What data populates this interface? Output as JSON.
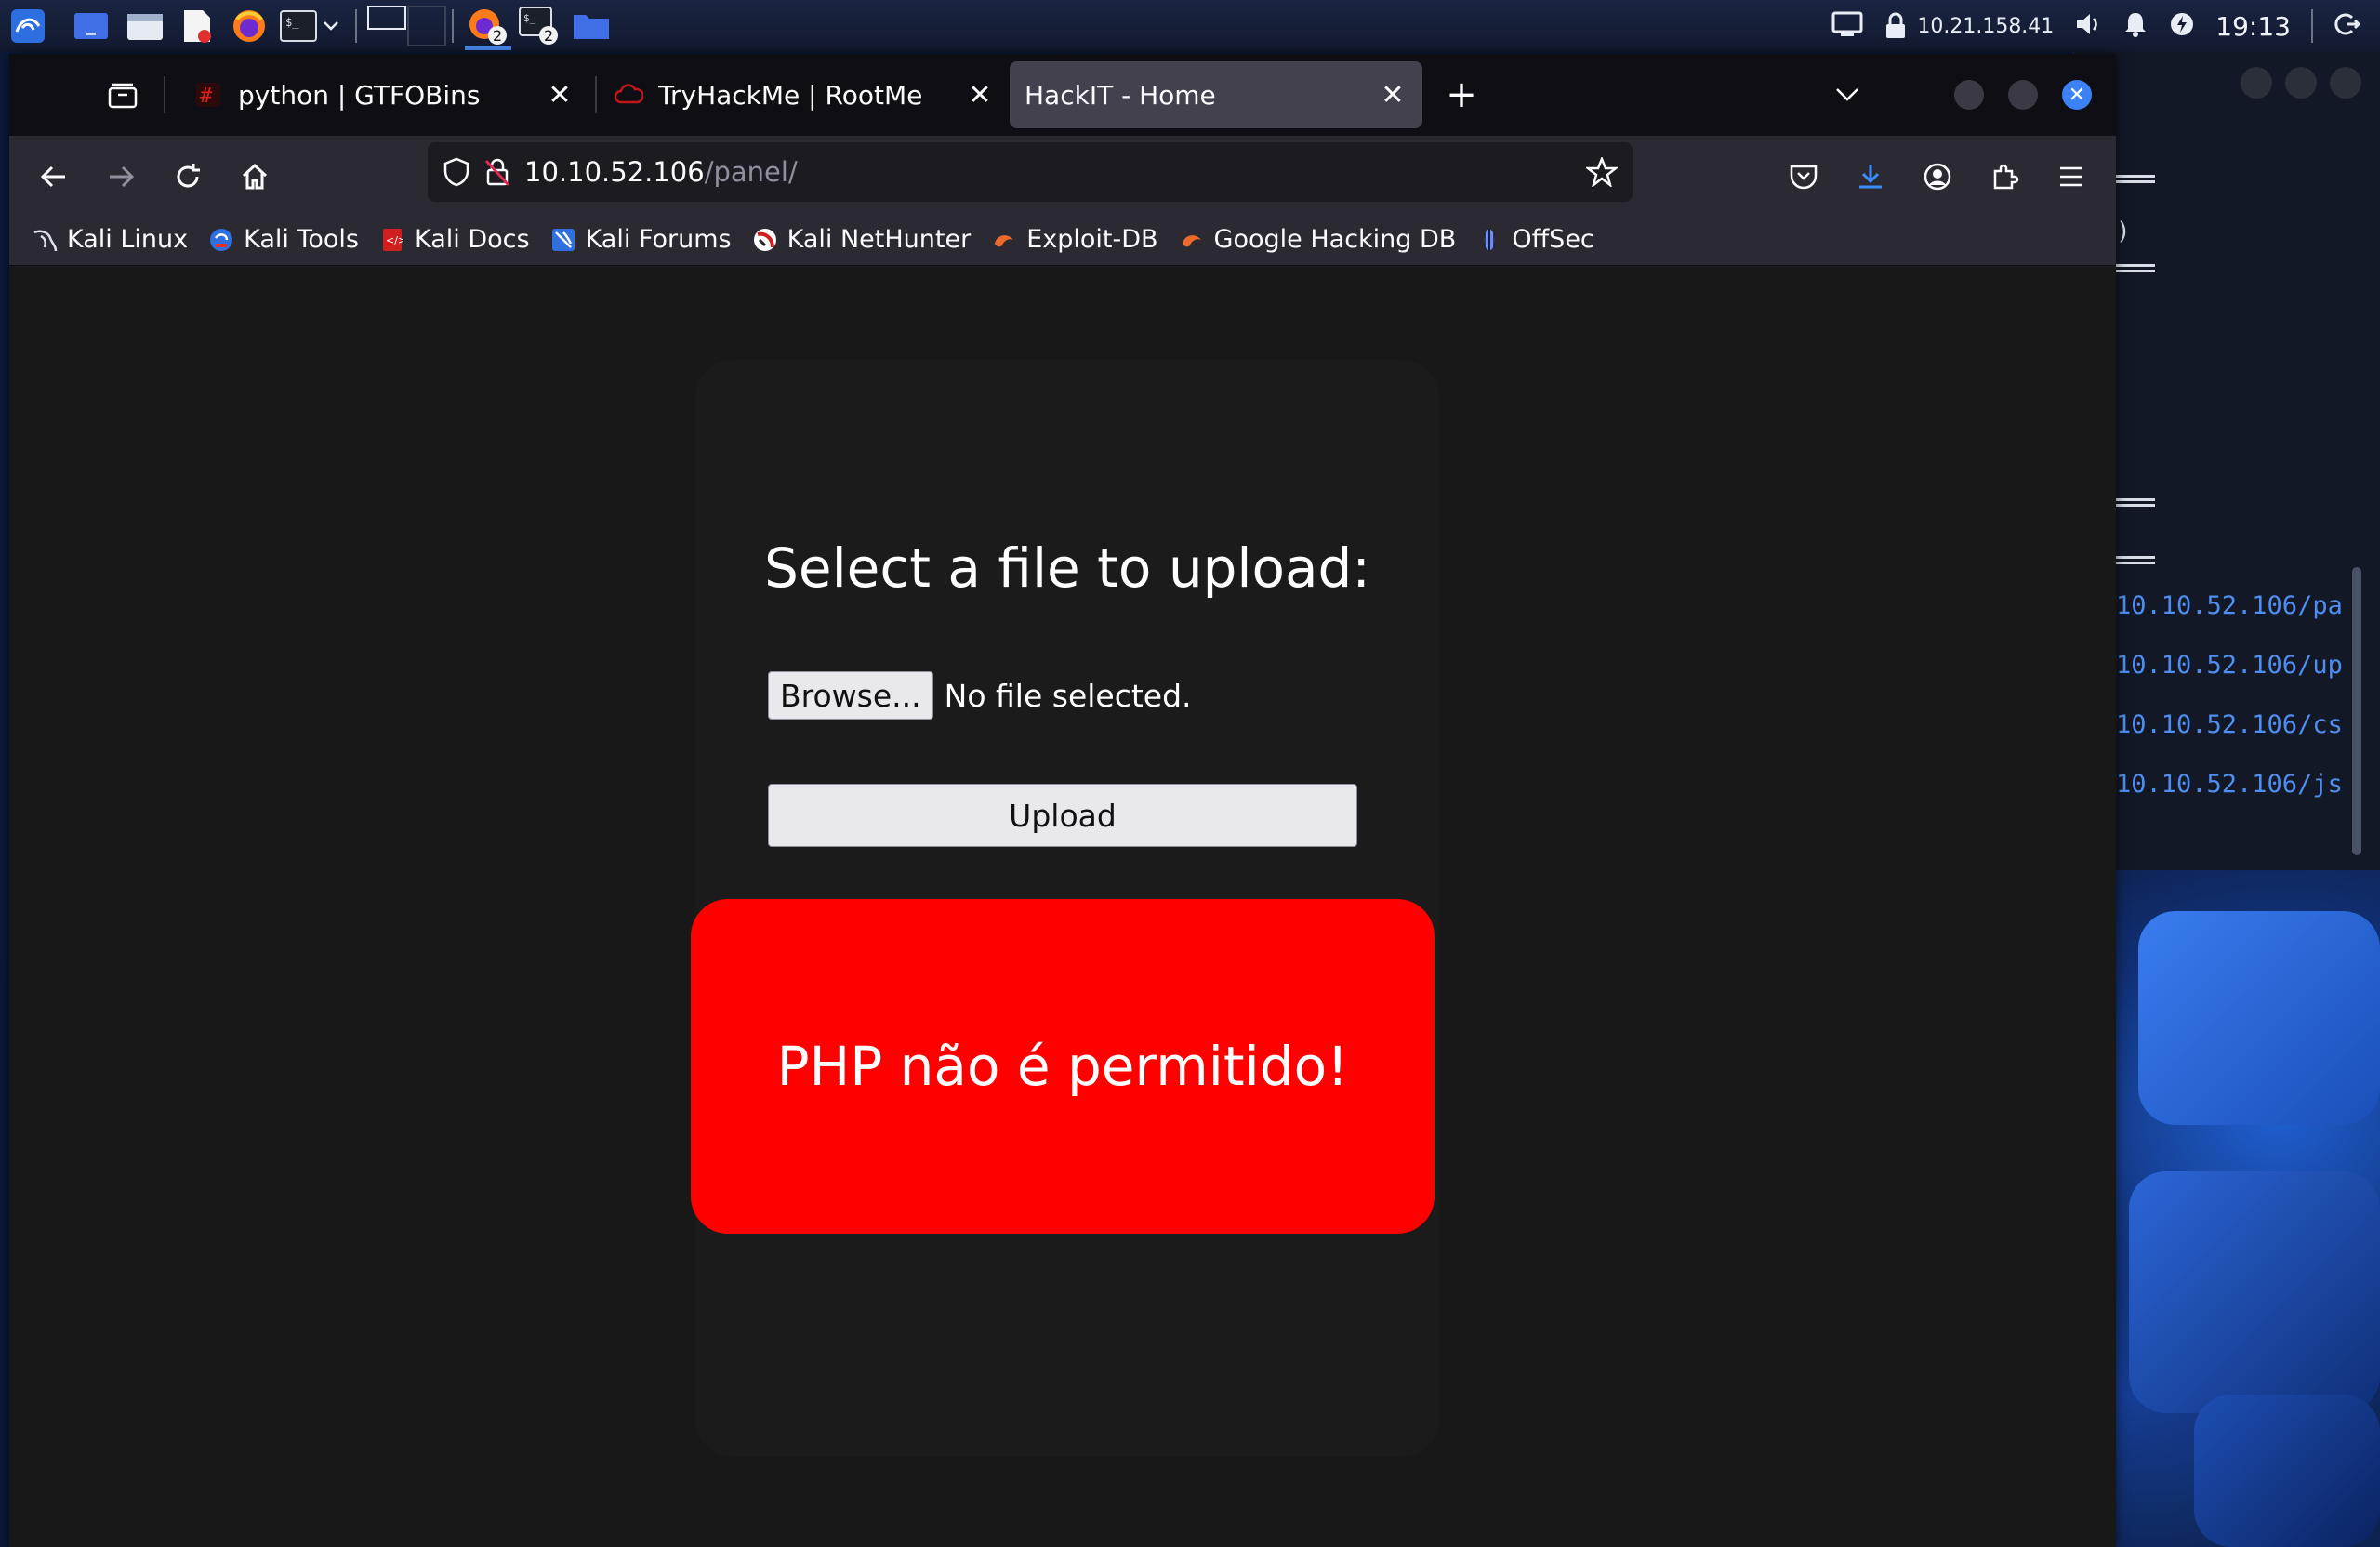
{
  "panel": {
    "ip": "10.21.158.41",
    "clock": "19:13",
    "firefox_badge": "2",
    "terminal_badge": "2"
  },
  "browser": {
    "tabs": [
      {
        "title": "python | GTFOBins",
        "favicon": "hash-icon"
      },
      {
        "title": "TryHackMe | RootMe",
        "favicon": "cloud-icon"
      },
      {
        "title": "HackIT - Home",
        "favicon": "none",
        "active": true
      }
    ],
    "url": {
      "host": "10.10.52.106",
      "path": "/panel/"
    },
    "bookmarks": [
      {
        "label": "Kali Linux",
        "icon": "kali-dragon-icon"
      },
      {
        "label": "Kali Tools",
        "icon": "kali-tools-icon"
      },
      {
        "label": "Kali Docs",
        "icon": "kali-docs-icon"
      },
      {
        "label": "Kali Forums",
        "icon": "kali-forums-icon"
      },
      {
        "label": "Kali NetHunter",
        "icon": "nethunter-icon"
      },
      {
        "label": "Exploit-DB",
        "icon": "exploit-db-icon"
      },
      {
        "label": "Google Hacking DB",
        "icon": "ghdb-icon"
      },
      {
        "label": "OffSec",
        "icon": "offsec-icon"
      }
    ]
  },
  "page": {
    "heading": "Select a file to upload:",
    "browse_label": "Browse...",
    "no_file_text": "No file selected.",
    "upload_label": "Upload",
    "error_message": "PHP não é permitido!",
    "error_color": "#ff0000"
  },
  "terminal": {
    "lines": [
      "10.10.52.106/pa",
      "10.10.52.106/up",
      "10.10.52.106/cs",
      "10.10.52.106/js"
    ],
    "paren": ")"
  }
}
